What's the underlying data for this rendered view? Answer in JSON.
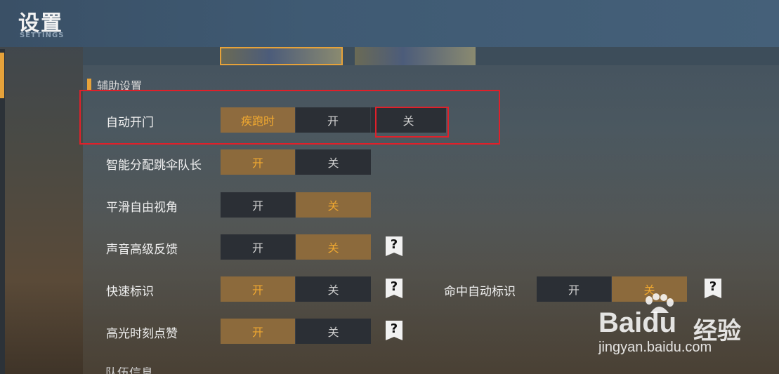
{
  "header": {
    "title": "设置",
    "subtitle": "SETTINGS"
  },
  "section": {
    "title": "辅助设置"
  },
  "rows": [
    {
      "label": "自动开门",
      "options": [
        "疾跑时",
        "开",
        "关"
      ],
      "selected": 0,
      "help": false
    },
    {
      "label": "智能分配跳伞队长",
      "options": [
        "开",
        "关"
      ],
      "selected": 0,
      "help": false
    },
    {
      "label": "平滑自由视角",
      "options": [
        "开",
        "关"
      ],
      "selected": 1,
      "help": false
    },
    {
      "label": "声音高级反馈",
      "options": [
        "开",
        "关"
      ],
      "selected": 1,
      "help": true
    },
    {
      "label": "快速标识",
      "options": [
        "开",
        "关"
      ],
      "selected": 0,
      "help": true
    },
    {
      "label": "命中自动标识",
      "options": [
        "开",
        "关"
      ],
      "selected": 1,
      "help": true
    },
    {
      "label": "高光时刻点赞",
      "options": [
        "开",
        "关"
      ],
      "selected": 0,
      "help": true
    }
  ],
  "partial_label": "队伍信息",
  "help_glyph": "?",
  "watermark": {
    "logo": "Bai",
    "logo2": "du",
    "cn": "经验",
    "url": "jingyan.baidu.com"
  },
  "colors": {
    "accent": "#e6a23a",
    "highlight_box": "#e0202a",
    "option_bg": "#2b2f35",
    "option_on_bg": "#8c6a3c"
  }
}
